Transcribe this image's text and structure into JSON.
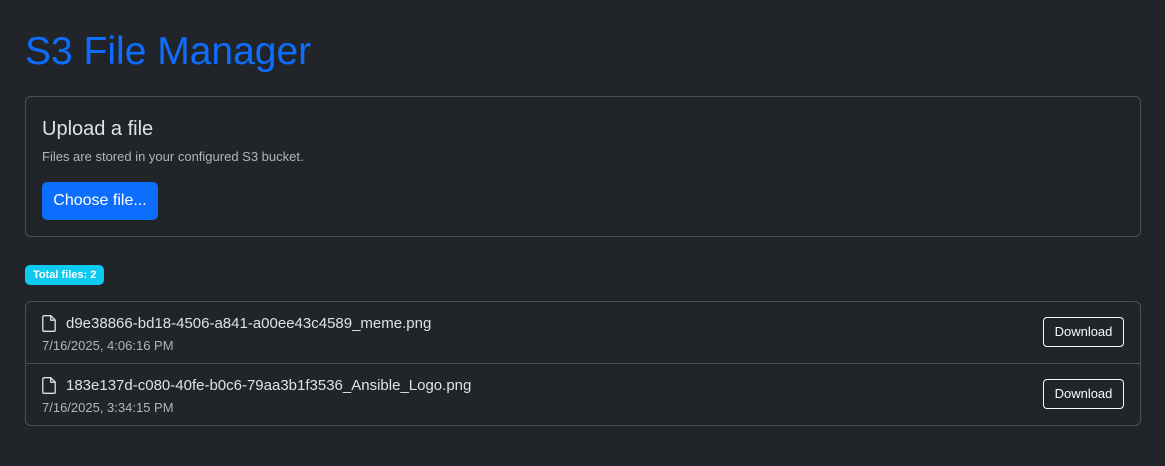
{
  "header": {
    "title": "S3 File Manager"
  },
  "upload": {
    "title": "Upload a file",
    "help_text": "Files are stored in your configured S3 bucket.",
    "button_label": "Choose file..."
  },
  "files": {
    "count_label": "Total files: 2",
    "items": [
      {
        "name": "d9e38866-bd18-4506-a841-a00ee43c4589_meme.png",
        "date": "7/16/2025, 4:06:16 PM",
        "icon": "file-icon",
        "download_label": "Download"
      },
      {
        "name": "183e137d-c080-40fe-b0c6-79aa3b1f3536_Ansible_Logo.png",
        "date": "7/16/2025, 3:34:15 PM",
        "icon": "file-icon",
        "download_label": "Download"
      }
    ]
  },
  "colors": {
    "background": "#212529",
    "primary": "#0d6efd",
    "info": "#0dcaf0",
    "border": "#495057",
    "muted_text": "#adb5bd"
  }
}
